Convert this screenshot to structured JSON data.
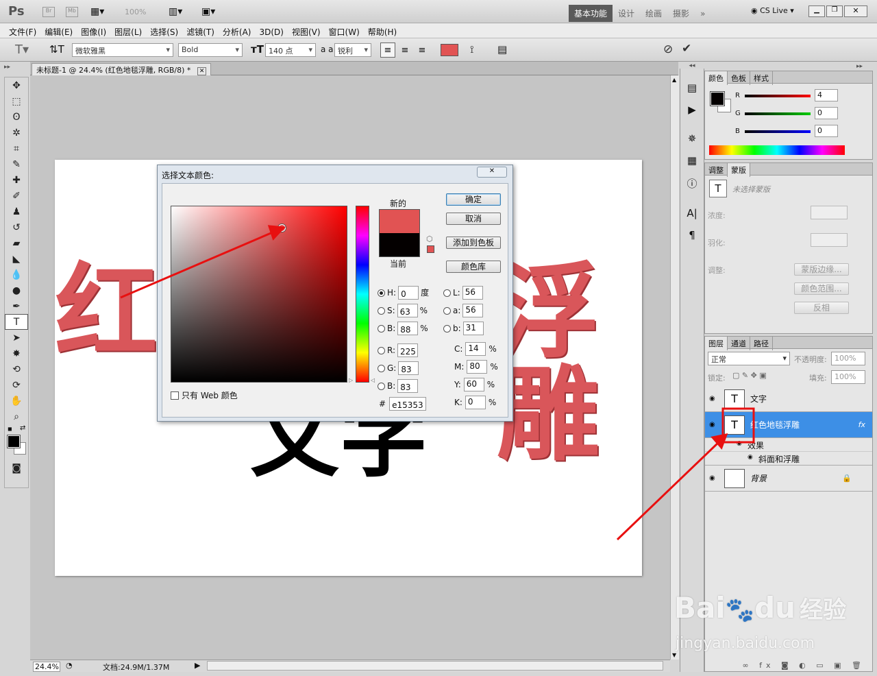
{
  "appbar": {
    "logo": "Ps",
    "br": "Br",
    "mb": "Mb",
    "zoom": "100%",
    "workspaces": [
      "基本功能",
      "设计",
      "绘画",
      "摄影"
    ],
    "more": "»",
    "cslive": "CS Live"
  },
  "menu": [
    "文件(F)",
    "编辑(E)",
    "图像(I)",
    "图层(L)",
    "选择(S)",
    "滤镜(T)",
    "分析(A)",
    "3D(D)",
    "视图(V)",
    "窗口(W)",
    "帮助(H)"
  ],
  "options": {
    "font_family": "微软雅黑",
    "font_style": "Bold",
    "font_size": "140 点",
    "aa_label": "a a",
    "antialias": "锐利",
    "text_color": "#e15353"
  },
  "document": {
    "tab_title": "未标题-1 @ 24.4% (红色地毯浮雕, RGB/8) *",
    "text_red_left": "红",
    "text_red_right": "浮雕",
    "text_black": "文字",
    "zoom": "24.4%",
    "doc_info": "文档:24.9M/1.37M"
  },
  "dialog": {
    "title": "选择文本颜色:",
    "new_label": "新的",
    "current_label": "当前",
    "ok": "确定",
    "cancel": "取消",
    "add_swatch": "添加到色板",
    "color_libraries": "颜色库",
    "web_only": "只有 Web 颜色",
    "hash": "#",
    "hex": "e15353",
    "new_color": "#e15353",
    "current_color": "#040000",
    "hsb": {
      "h_label": "H:",
      "h": "0",
      "h_unit": "度",
      "s_label": "S:",
      "s": "63",
      "s_unit": "%",
      "b_label": "B:",
      "b": "88",
      "b_unit": "%"
    },
    "lab": {
      "l_label": "L:",
      "l": "56",
      "a_label": "a:",
      "a": "56",
      "b_label": "b:",
      "b": "31"
    },
    "rgb": {
      "r_label": "R:",
      "r": "225",
      "g_label": "G:",
      "g": "83",
      "b_label": "B:",
      "b": "83"
    },
    "cmyk": {
      "c_label": "C:",
      "c": "14",
      "m_label": "M:",
      "m": "80",
      "y_label": "Y:",
      "y": "60",
      "k_label": "K:",
      "k": "0",
      "unit": "%"
    }
  },
  "color_panel": {
    "tabs": [
      "颜色",
      "色板",
      "样式"
    ],
    "r_label": "R",
    "r": "4",
    "g_label": "G",
    "g": "0",
    "b_label": "B",
    "b": "0"
  },
  "adjust_panel": {
    "tabs": [
      "调整",
      "蒙版"
    ],
    "no_mask": "未选择蒙版",
    "density": "浓度:",
    "feather": "羽化:",
    "refine": "调整:",
    "mask_edge": "蒙版边缘...",
    "color_range": "颜色范围...",
    "invert": "反相"
  },
  "layers_panel": {
    "tabs": [
      "图层",
      "通道",
      "路径"
    ],
    "blend_mode": "正常",
    "opacity_label": "不透明度:",
    "opacity": "100%",
    "lock_label": "锁定:",
    "fill_label": "填充:",
    "fill": "100%",
    "layers": [
      {
        "name": "文字",
        "thumb": "T"
      },
      {
        "name": "红色地毯浮雕",
        "thumb": "T",
        "fx": "fx"
      },
      {
        "name": "效果"
      },
      {
        "name": "斜面和浮雕"
      },
      {
        "name": "背景"
      }
    ]
  },
  "watermark": {
    "brand": "Bai",
    "brand2": "du",
    "cn": "经验",
    "url": "jingyan.baidu.com"
  },
  "annotation_color": "#e81010"
}
